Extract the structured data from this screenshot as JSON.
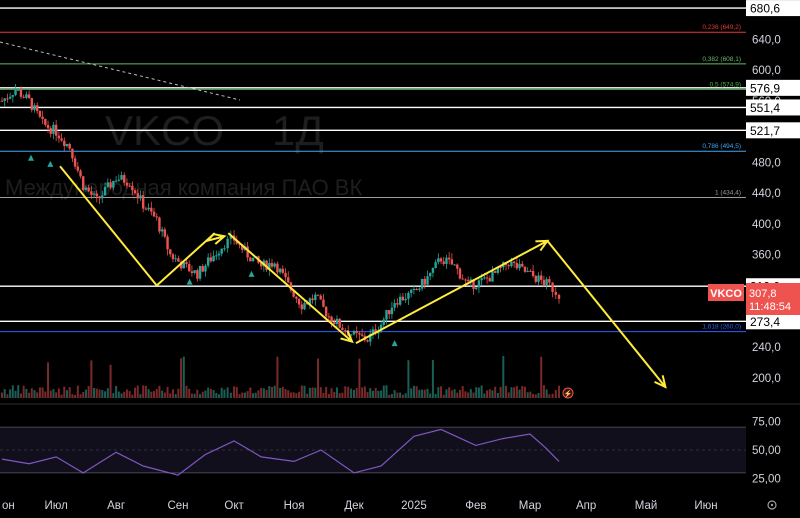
{
  "chart_data": {
    "type": "candlestick",
    "ticker": "VKCO",
    "interval": "1Д",
    "company": "Международная компания ПАО ВК",
    "last_price": "307,8",
    "countdown": "11:48:54",
    "y_axis_ticks": [
      200,
      240,
      280,
      320,
      360,
      400,
      440,
      480,
      520,
      560,
      600,
      640
    ],
    "y_axis_tick_labels": [
      "200,0",
      "240,0",
      "280,0",
      "320,0",
      "360,0",
      "400,0",
      "440,0",
      "480,0",
      "520,0",
      "560,0",
      "600,0",
      "640,0"
    ],
    "ylim": [
      175,
      682
    ],
    "x_axis_labels": [
      "он",
      "Июл",
      "Авг",
      "Сен",
      "Окт",
      "Ноя",
      "Дек",
      "2025",
      "Фев",
      "Мар",
      "Апр",
      "Май",
      "Июн"
    ],
    "x_axis_label_dates": [
      "2024-06-03",
      "2024-07-01",
      "2024-08-01",
      "2024-09-02",
      "2024-10-01",
      "2024-11-01",
      "2024-12-02",
      "2025-01-02",
      "2025-02-03",
      "2025-03-03",
      "2025-04-01",
      "2025-05-02",
      "2025-06-02"
    ],
    "horizontal_levels": [
      {
        "price": 680.6,
        "label": "680,6",
        "color": "#ffffff",
        "badge": true
      },
      {
        "price": 649.2,
        "label": "0,236 (649,2)",
        "color": "#e53935",
        "badge": false
      },
      {
        "price": 608.1,
        "label": "0,382 (608,1)",
        "color": "#66bb6a",
        "badge": false
      },
      {
        "price": 576.9,
        "label": "576,9",
        "color": "#ffffff",
        "badge": true
      },
      {
        "price": 574.9,
        "label": "0,5 (574,9)",
        "color": "#4caf50",
        "badge": false
      },
      {
        "price": 551.4,
        "label": "551,4",
        "color": "#ffffff",
        "badge": true
      },
      {
        "price": 521.7,
        "label": "521,7",
        "color": "#ffffff",
        "badge": true
      },
      {
        "price": 494.5,
        "label": "0,786 (494,5)",
        "color": "#42a5f5",
        "badge": false
      },
      {
        "price": 434.4,
        "label": "1 (434,4)",
        "color": "#9e9e9e",
        "badge": false
      },
      {
        "price": 319.0,
        "label": "319,0",
        "color": "#ffffff",
        "badge": true
      },
      {
        "price": 273.4,
        "label": "273,4",
        "color": "#ffffff",
        "badge": true
      },
      {
        "price": 260.0,
        "label": "1,618 (260,0)",
        "color": "#2962ff",
        "badge": false
      }
    ],
    "price_series": [
      {
        "date": "2024-06-03",
        "close": 560
      },
      {
        "date": "2024-06-10",
        "close": 575
      },
      {
        "date": "2024-06-17",
        "close": 560
      },
      {
        "date": "2024-06-24",
        "close": 530
      },
      {
        "date": "2024-07-01",
        "close": 520
      },
      {
        "date": "2024-07-08",
        "close": 500
      },
      {
        "date": "2024-07-15",
        "close": 450
      },
      {
        "date": "2024-07-22",
        "close": 430
      },
      {
        "date": "2024-08-01",
        "close": 460
      },
      {
        "date": "2024-08-08",
        "close": 455
      },
      {
        "date": "2024-08-15",
        "close": 425
      },
      {
        "date": "2024-08-22",
        "close": 405
      },
      {
        "date": "2024-08-29",
        "close": 360
      },
      {
        "date": "2024-09-05",
        "close": 345
      },
      {
        "date": "2024-09-12",
        "close": 335
      },
      {
        "date": "2024-09-19",
        "close": 355
      },
      {
        "date": "2024-09-26",
        "close": 375
      },
      {
        "date": "2024-10-01",
        "close": 380
      },
      {
        "date": "2024-10-08",
        "close": 360
      },
      {
        "date": "2024-10-15",
        "close": 345
      },
      {
        "date": "2024-10-22",
        "close": 350
      },
      {
        "date": "2024-10-29",
        "close": 320
      },
      {
        "date": "2024-11-05",
        "close": 295
      },
      {
        "date": "2024-11-12",
        "close": 305
      },
      {
        "date": "2024-11-19",
        "close": 280
      },
      {
        "date": "2024-11-26",
        "close": 265
      },
      {
        "date": "2024-12-02",
        "close": 255
      },
      {
        "date": "2024-12-09",
        "close": 250
      },
      {
        "date": "2024-12-16",
        "close": 270
      },
      {
        "date": "2024-12-23",
        "close": 300
      },
      {
        "date": "2025-01-02",
        "close": 310
      },
      {
        "date": "2025-01-09",
        "close": 330
      },
      {
        "date": "2025-01-16",
        "close": 355
      },
      {
        "date": "2025-01-23",
        "close": 345
      },
      {
        "date": "2025-01-30",
        "close": 320
      },
      {
        "date": "2025-02-06",
        "close": 325
      },
      {
        "date": "2025-02-13",
        "close": 335
      },
      {
        "date": "2025-02-20",
        "close": 350
      },
      {
        "date": "2025-02-27",
        "close": 340
      },
      {
        "date": "2025-03-06",
        "close": 330
      },
      {
        "date": "2025-03-13",
        "close": 320
      },
      {
        "date": "2025-03-18",
        "close": 307.8
      }
    ],
    "rsi": {
      "ticks": [
        "75,00",
        "50,00",
        "25,00"
      ],
      "tick_values": [
        75,
        50,
        25
      ],
      "upper": 70,
      "mid": 50,
      "lower": 30,
      "color": "#7e57c2",
      "series": [
        {
          "date": "2024-06-03",
          "value": 42
        },
        {
          "date": "2024-06-17",
          "value": 38
        },
        {
          "date": "2024-07-01",
          "value": 44
        },
        {
          "date": "2024-07-15",
          "value": 30
        },
        {
          "date": "2024-08-01",
          "value": 48
        },
        {
          "date": "2024-08-15",
          "value": 36
        },
        {
          "date": "2024-09-02",
          "value": 28
        },
        {
          "date": "2024-09-16",
          "value": 46
        },
        {
          "date": "2024-10-01",
          "value": 58
        },
        {
          "date": "2024-10-15",
          "value": 44
        },
        {
          "date": "2024-11-01",
          "value": 40
        },
        {
          "date": "2024-11-15",
          "value": 50
        },
        {
          "date": "2024-12-02",
          "value": 30
        },
        {
          "date": "2024-12-16",
          "value": 36
        },
        {
          "date": "2025-01-02",
          "value": 62
        },
        {
          "date": "2025-01-16",
          "value": 68
        },
        {
          "date": "2025-02-03",
          "value": 54
        },
        {
          "date": "2025-02-17",
          "value": 60
        },
        {
          "date": "2025-03-03",
          "value": 64
        },
        {
          "date": "2025-03-11",
          "value": 52
        },
        {
          "date": "2025-03-18",
          "value": 40
        }
      ]
    },
    "annotations": {
      "arrows": [
        {
          "points": [
            [
              "2024-07-03",
              475
            ],
            [
              "2024-08-22",
              320
            ]
          ],
          "color": "#ffeb3b"
        },
        {
          "points": [
            [
              "2024-08-22",
              320
            ],
            [
              "2024-09-21",
              388
            ]
          ],
          "color": "#ffeb3b"
        },
        {
          "points": [
            [
              "2024-09-21",
              388
            ],
            [
              "2024-09-17",
              378
            ],
            [
              "2024-09-26",
              384
            ]
          ],
          "color": "#ffeb3b",
          "arrowhead": true
        },
        {
          "points": [
            [
              "2024-09-28",
              388
            ],
            [
              "2024-12-01",
              247
            ]
          ],
          "color": "#ffeb3b",
          "arrowhead": true
        },
        {
          "points": [
            [
              "2024-12-03",
              245
            ],
            [
              "2025-03-12",
              378
            ]
          ],
          "color": "#ffeb3b",
          "arrowhead": true
        },
        {
          "points": [
            [
              "2025-03-12",
              378
            ],
            [
              "2025-05-12",
              188
            ]
          ],
          "color": "#ffeb3b",
          "arrowhead": true
        }
      ]
    },
    "colors": {
      "up": "#26a69a",
      "down": "#ef5350",
      "price_badge": "#ef5350",
      "text": "#d1d4dc"
    }
  }
}
